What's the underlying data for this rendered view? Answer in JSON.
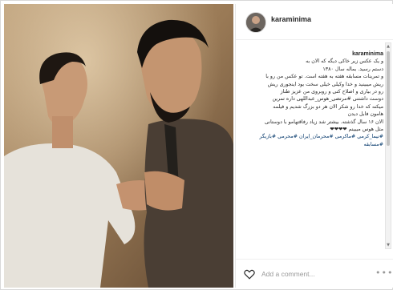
{
  "post": {
    "username": "karaminima",
    "caption_username": "karaminima",
    "caption_lines": [
      "و یک عکس زیر خاکی دیگه که الان به",
      "دستم رسید. بماله سال ۱۳۸۰",
      "و تمرینات مسابقه هفته به هفته است. تو عکس من رو با",
      "ریش میبینید و خدا وکیلی خیلی سخت بود اینجوری ریش",
      "رو در بیاری و اصلاح کنی و روبروی من عزیز طناز",
      "دوست داشتنی #مرتضی_هوس_عبداللهی داره تمرین",
      "میکنه که خدا رو شکر الان هر دو بزرگ شدیم و فیلمه",
      "هامون فابل دیدن",
      "الان ۱۶ سال گذشته. بیشتر شد زیاد رفاقتهامو با دوستانی",
      "مثل هوس میبینم ❤❤❤❤"
    ],
    "hashtags": "#نیما_کرمی #ماکرمی #محرمان_ایران #محرمی #بازیگر #مسابقه",
    "add_comment_placeholder": "Add a comment...",
    "more_label": "•••"
  },
  "colors": {
    "text": "#262626",
    "hashtag": "#003569",
    "muted": "#999999",
    "border": "#efefef"
  },
  "icons": {
    "like": "heart-outline-icon",
    "more": "ellipsis-icon"
  }
}
